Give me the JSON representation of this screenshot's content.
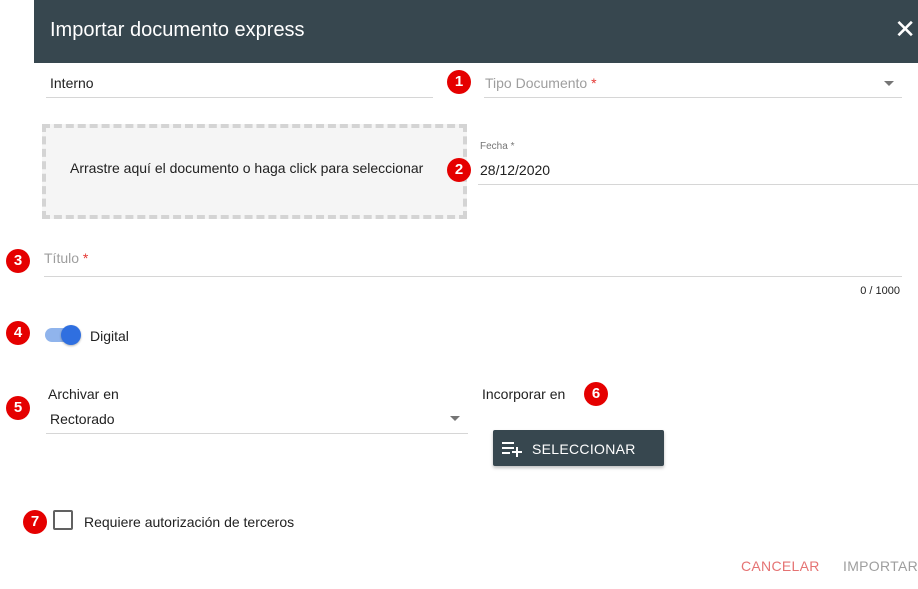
{
  "dialog": {
    "title": "Importar documento express",
    "close_glyph": "✕"
  },
  "form": {
    "origin_value": "Interno",
    "doc_type": {
      "label": "Tipo Documento",
      "required_mark": "*"
    },
    "dropzone_text": "Arrastre aquí el documento o haga click para seleccionar",
    "date": {
      "label": "Fecha *",
      "value": "28/12/2020"
    },
    "title_field": {
      "label": "Título",
      "required_mark": "*",
      "counter": "0 / 1000"
    },
    "digital_toggle": {
      "label": "Digital",
      "on": true
    },
    "archive_in": {
      "label": "Archivar en",
      "value": "Rectorado"
    },
    "incorporate_in": {
      "label": "Incorporar en",
      "button_label": "SELECCIONAR",
      "button_icon": "playlist-add-icon"
    },
    "third_party_auth": {
      "label": "Requiere autorización de terceros",
      "checked": false
    }
  },
  "actions": {
    "cancel_label": "CANCELAR",
    "import_label": "IMPORTAR"
  },
  "annotations": [
    "1",
    "2",
    "3",
    "4",
    "5",
    "6",
    "7"
  ],
  "colors": {
    "header_bg": "#37474f",
    "badge": "#e50000",
    "cancel": "#e57373",
    "import_disabled": "#9e9e9e",
    "toggle_thumb": "#2f6fe0",
    "toggle_track": "#90b4ec"
  }
}
